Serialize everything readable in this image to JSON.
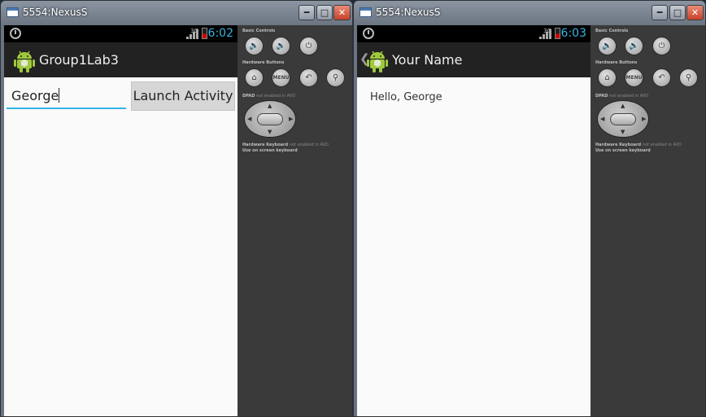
{
  "windows": [
    {
      "title": "5554:NexusS",
      "status_time": "6:02",
      "network": "3G",
      "app_title": "Group1Lab3",
      "name_input_value": "George",
      "launch_button_label": "Launch Activity"
    },
    {
      "title": "5554:NexusS",
      "status_time": "6:03",
      "network": "3G",
      "app_title": "Your Name",
      "greeting": "Hello, George"
    }
  ],
  "controls": {
    "basic_label": "Basic Controls",
    "hardware_label": "Hardware Buttons",
    "menu_label": "MENU",
    "dpad_label": "DPAD",
    "dpad_note": "not enabled in AVD",
    "keyboard_label": "Hardware Keyboard",
    "keyboard_note": "not enabled in AVD",
    "onscreen_label": "Use on screen keyboard"
  },
  "colors": {
    "accent": "#33b5e5",
    "action_bar": "#222222",
    "status_bar": "#000000",
    "panel": "#3a3a3a",
    "close_button": "#c8412a"
  },
  "icons": [
    "window-icon",
    "minimize-icon",
    "maximize-icon",
    "close-icon",
    "timer-icon",
    "signal-icon",
    "battery-icon",
    "android-icon",
    "volume-down-icon",
    "volume-up-icon",
    "power-icon",
    "home-icon",
    "back-icon",
    "search-icon",
    "dpad-icon"
  ]
}
